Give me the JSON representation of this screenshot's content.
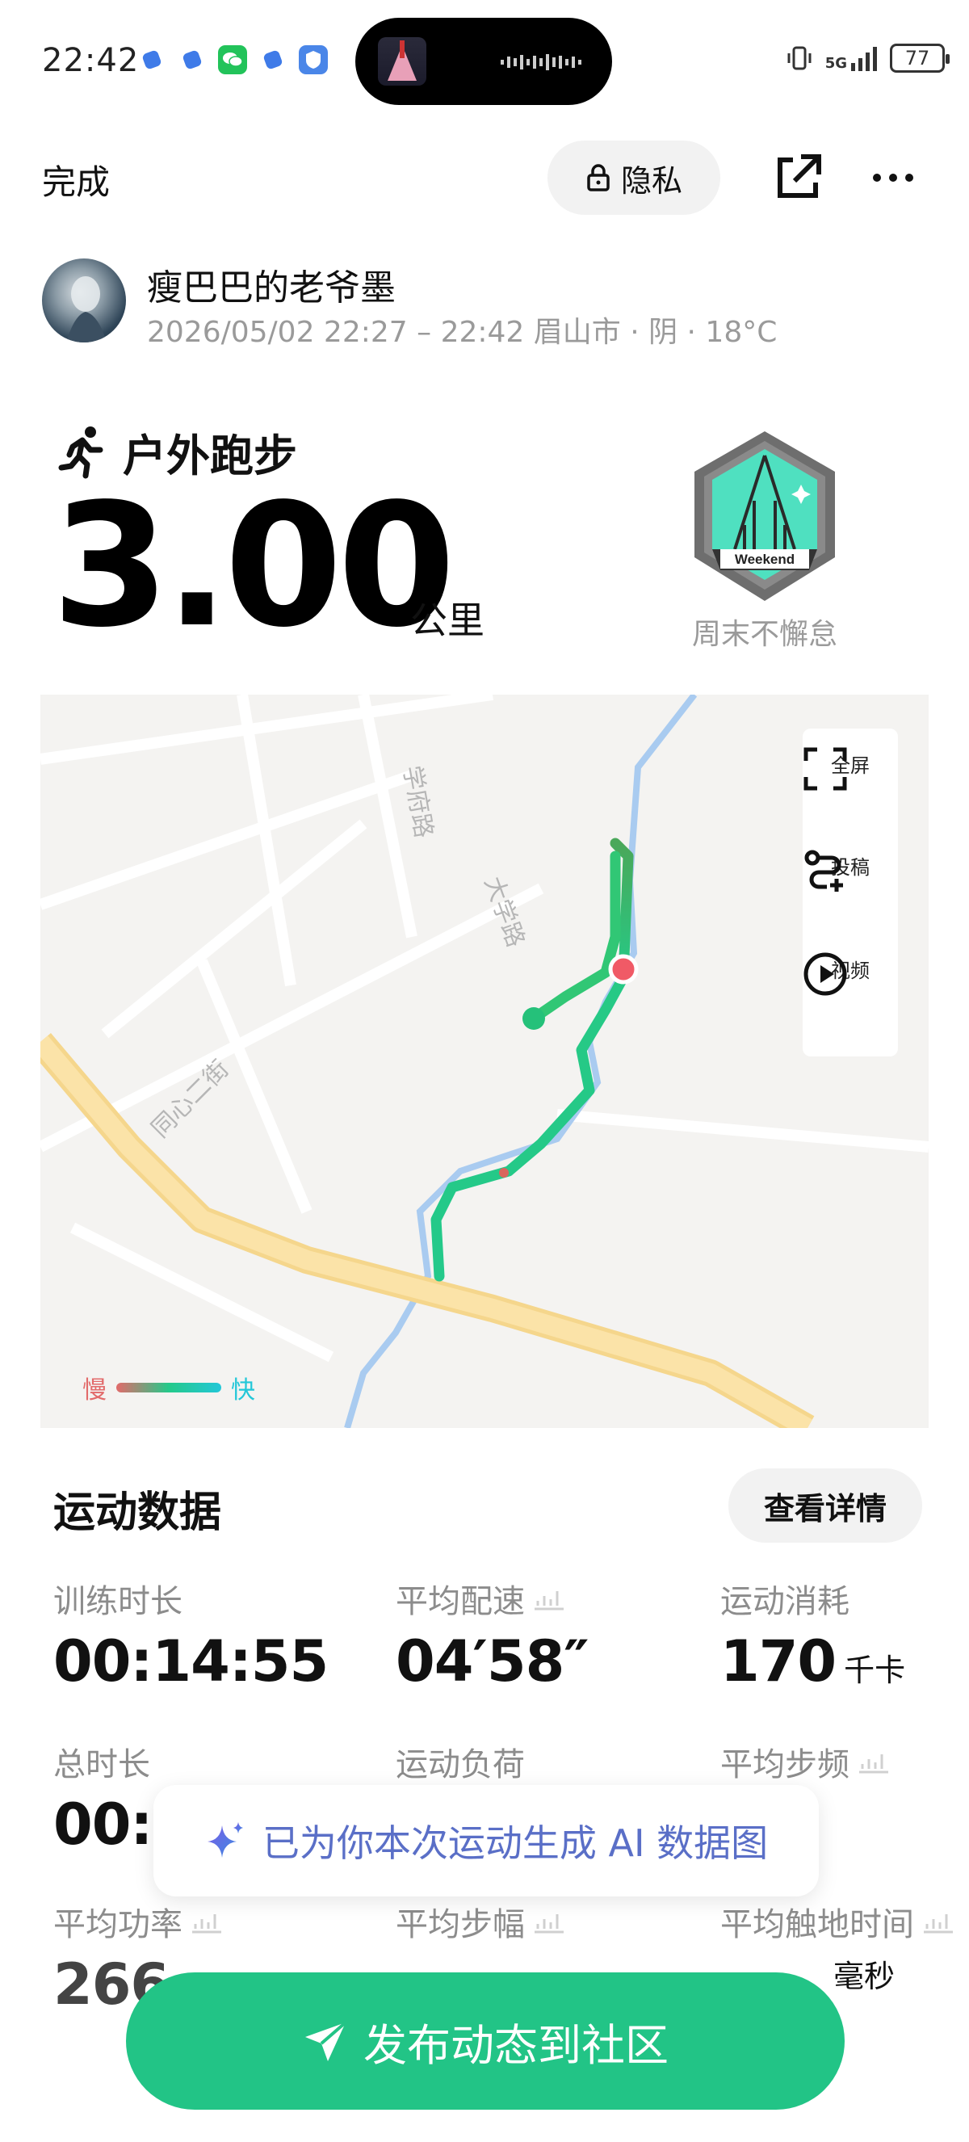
{
  "status_bar": {
    "time": "22:42",
    "battery": "77",
    "network": "5G"
  },
  "nav": {
    "done_label": "完成",
    "privacy_label": "隐私"
  },
  "user": {
    "name": "瘦巴巴的老爷墨",
    "meta": "2026/05/02 22:27 – 22:42 眉山市 · 阴 · 18°C"
  },
  "activity": {
    "type": "户外跑步",
    "distance": "3.00",
    "distance_unit": "公里",
    "badge_text": "Weekend",
    "badge_name": "周末不懈怠"
  },
  "map": {
    "labels": {
      "road1": "学府路",
      "road2": "大学路",
      "road3": "同心二街"
    },
    "tools": {
      "fullscreen": "全屏",
      "submit": "投稿",
      "video": "视频"
    },
    "legend": {
      "slow": "慢",
      "fast": "快"
    },
    "colors": {
      "slow": "#e26a6a",
      "mid": "#24c98a",
      "fast": "#23c7d8"
    }
  },
  "stats": {
    "title": "运动数据",
    "detail_label": "查看详情",
    "items": [
      {
        "label": "训练时长",
        "value": "00:14:55",
        "unit": ""
      },
      {
        "label": "平均配速",
        "value": "04′58″",
        "unit": ""
      },
      {
        "label": "运动消耗",
        "value": "170",
        "unit": "千卡"
      },
      {
        "label": "总时长",
        "value": "00:1",
        "unit": ""
      },
      {
        "label": "运动负荷",
        "value": "",
        "unit": ""
      },
      {
        "label": "平均步频",
        "value": "",
        "unit": ""
      },
      {
        "label": "平均功率",
        "value": "266",
        "unit": ""
      },
      {
        "label": "平均步幅",
        "value": "",
        "unit": ""
      },
      {
        "label": "平均触地时间",
        "value": "",
        "unit": "毫秒"
      }
    ]
  },
  "ai_toast": {
    "text": "已为你本次运动生成 AI 数据图"
  },
  "publish": {
    "label": "发布动态到社区"
  }
}
